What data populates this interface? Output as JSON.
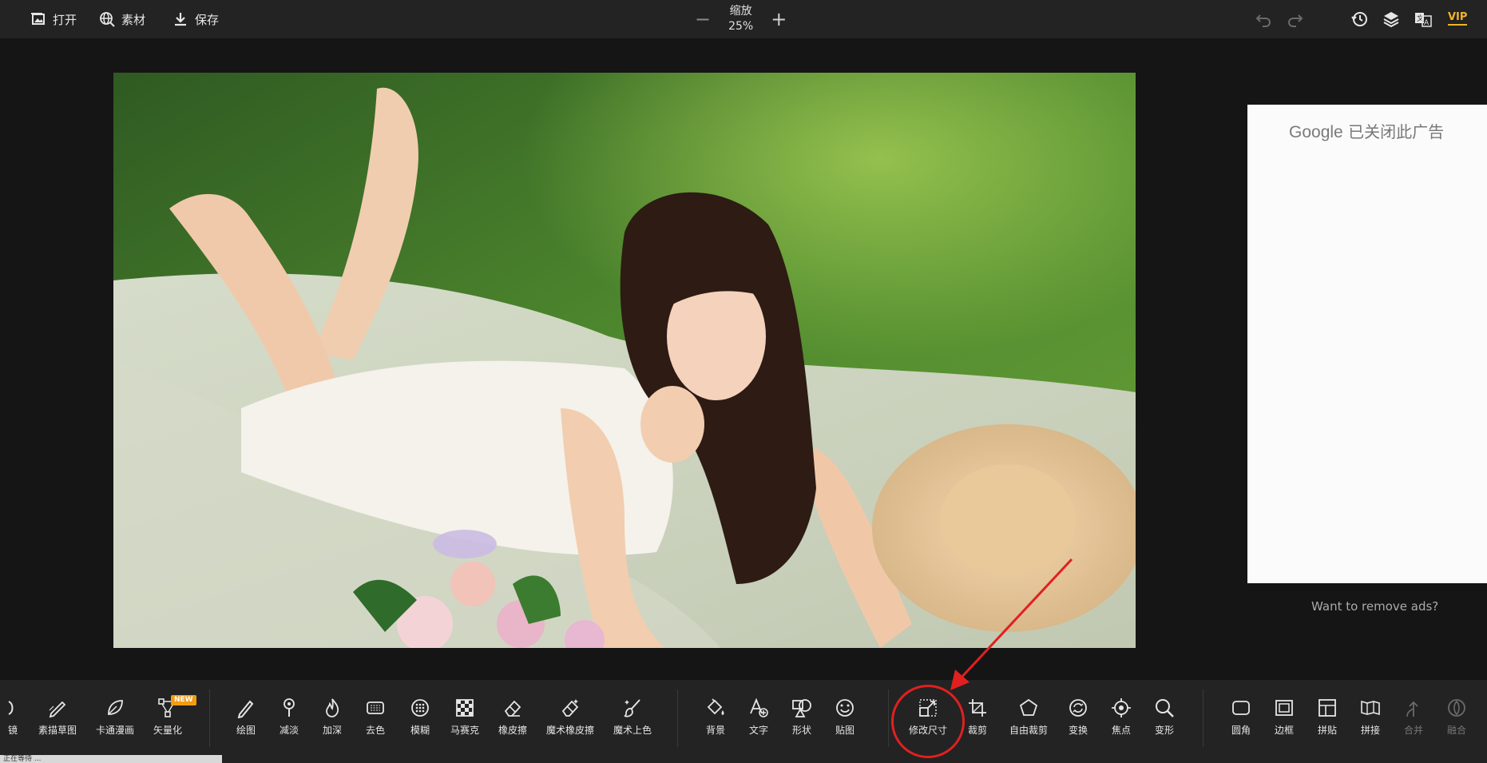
{
  "topbar": {
    "open_label": "打开",
    "material_label": "素材",
    "save_label": "保存",
    "zoom_title": "缩放",
    "zoom_value": "25%"
  },
  "vip_label": "VIP",
  "ad": {
    "brand": "Google",
    "closed_text": "已关闭此广告",
    "remove_ads": "Want to remove ads?"
  },
  "tools": {
    "t0": "镜",
    "t1": "素描草图",
    "t2": "卡通漫画",
    "t3": "矢量化",
    "new_badge": "NEW",
    "t4": "绘图",
    "t5": "减淡",
    "t6": "加深",
    "t7": "去色",
    "t8": "模糊",
    "t9": "马赛克",
    "t10": "橡皮擦",
    "t11": "魔术橡皮擦",
    "t12": "魔术上色",
    "t13": "背景",
    "t14": "文字",
    "t15": "形状",
    "t16": "贴图",
    "t17": "修改尺寸",
    "t18": "裁剪",
    "t19": "自由裁剪",
    "t20": "变换",
    "t21": "焦点",
    "t22": "变形",
    "t23": "圆角",
    "t24": "边框",
    "t25": "拼贴",
    "t26": "拼接",
    "t27": "合并",
    "t28": "融合"
  },
  "status_text": "正在等待 ...",
  "colors": {
    "background": "#141414",
    "toolbar": "#232323",
    "vip": "#f0b429",
    "highlight": "#e02020"
  }
}
